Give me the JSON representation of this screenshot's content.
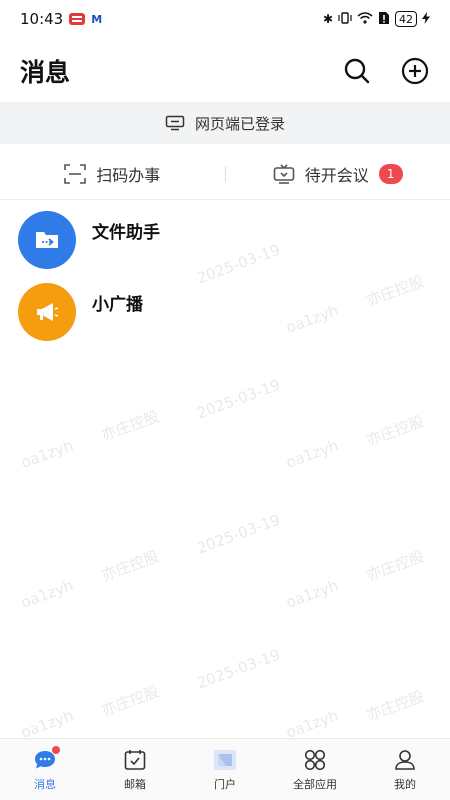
{
  "status_bar": {
    "time": "10:43",
    "notif_letter": "M",
    "battery": "42"
  },
  "header": {
    "title": "消息"
  },
  "web_banner": {
    "text": "网页端已登录"
  },
  "quick_actions": [
    {
      "label": "扫码办事"
    },
    {
      "label": "待开会议",
      "badge": "1"
    }
  ],
  "conversations": [
    {
      "name": "文件助手",
      "avatar_color": "#2f7ce8"
    },
    {
      "name": "小广播",
      "avatar_color": "#f59c0f"
    }
  ],
  "watermark": {
    "date": "2025-03-19",
    "company": "亦庄控股",
    "user": "oa1zyh"
  },
  "tabs": [
    {
      "label": "消息",
      "active": true
    },
    {
      "label": "邮箱"
    },
    {
      "label": "门户"
    },
    {
      "label": "全部应用"
    },
    {
      "label": "我的"
    }
  ],
  "colors": {
    "accent": "#2f7ce8",
    "badge": "#f0484f",
    "banner_bg": "#f2f3f5"
  }
}
